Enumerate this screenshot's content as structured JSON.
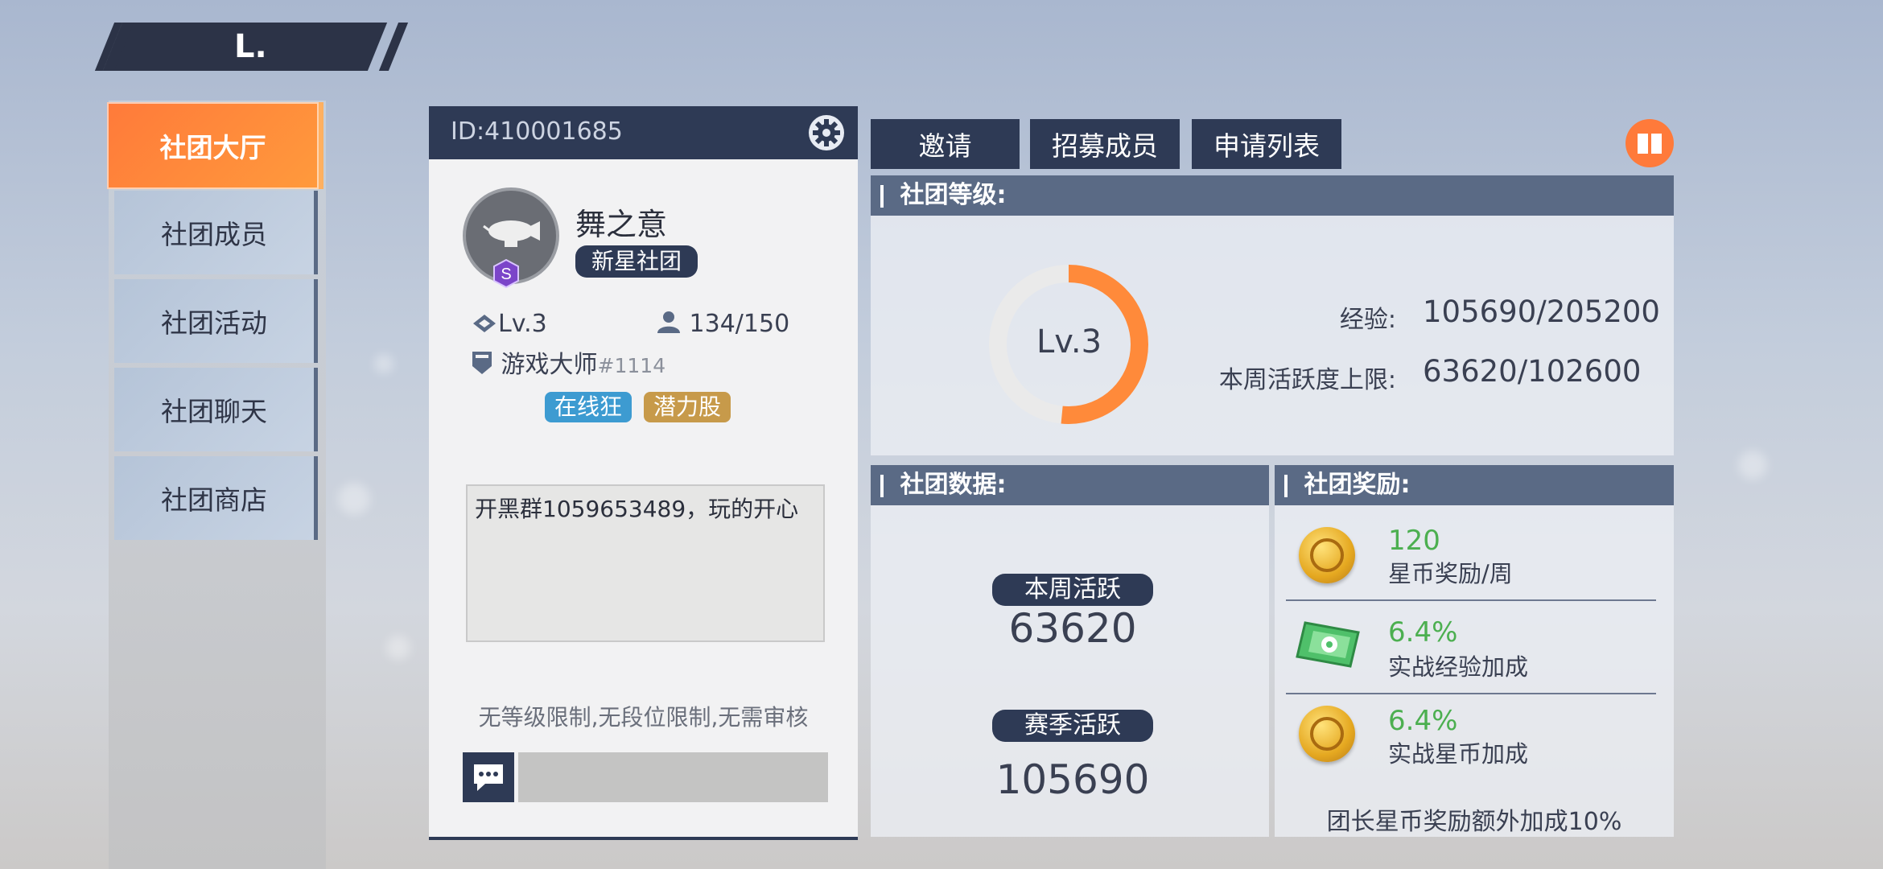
{
  "header": {
    "back_glyph": "L."
  },
  "sidebar": {
    "items": [
      {
        "label": "社团大厅",
        "active": true
      },
      {
        "label": "社团成员",
        "active": false
      },
      {
        "label": "社团活动",
        "active": false
      },
      {
        "label": "社团聊天",
        "active": false
      },
      {
        "label": "社团商店",
        "active": false
      }
    ]
  },
  "club_card": {
    "id_text": "ID:410001685",
    "name": "舞之意",
    "type_tag": "新星社团",
    "level": "Lv.3",
    "members": "134/150",
    "leader_name": "游戏大师",
    "leader_tag": "#1114",
    "tags": [
      "在线狂",
      "潜力股"
    ],
    "notice": "开黑群1059653489，玩的开心",
    "requirements": "无等级限制,无段位限制,无需审核"
  },
  "tabs": {
    "invite": "邀请",
    "recruit": "招募成员",
    "applications": "申请列表"
  },
  "level_section": {
    "title": "社团等级:",
    "level_label": "Lv.3",
    "exp_label": "经验:",
    "exp_value": "105690/205200",
    "weekly_cap_label": "本周活跃度上限:",
    "weekly_cap_value": "63620/102600",
    "progress_fraction": 0.515
  },
  "data_section": {
    "title": "社团数据:",
    "weekly_label": "本周活跃",
    "weekly_value": "63620",
    "season_label": "赛季活跃",
    "season_value": "105690"
  },
  "rewards_section": {
    "title": "社团奖励:",
    "items": [
      {
        "value": "120",
        "desc": "星币奖励/周",
        "icon": "star-coin-icon"
      },
      {
        "value": "6.4%",
        "desc": "实战经验加成",
        "icon": "exp-card-icon"
      },
      {
        "value": "6.4%",
        "desc": "实战星币加成",
        "icon": "star-coin-icon"
      }
    ],
    "leader_bonus": "团长星币奖励额外加成10%"
  },
  "colors": {
    "accent": "#ff7a3a",
    "navy": "#2e3a55",
    "reward_green": "#4caf50"
  }
}
